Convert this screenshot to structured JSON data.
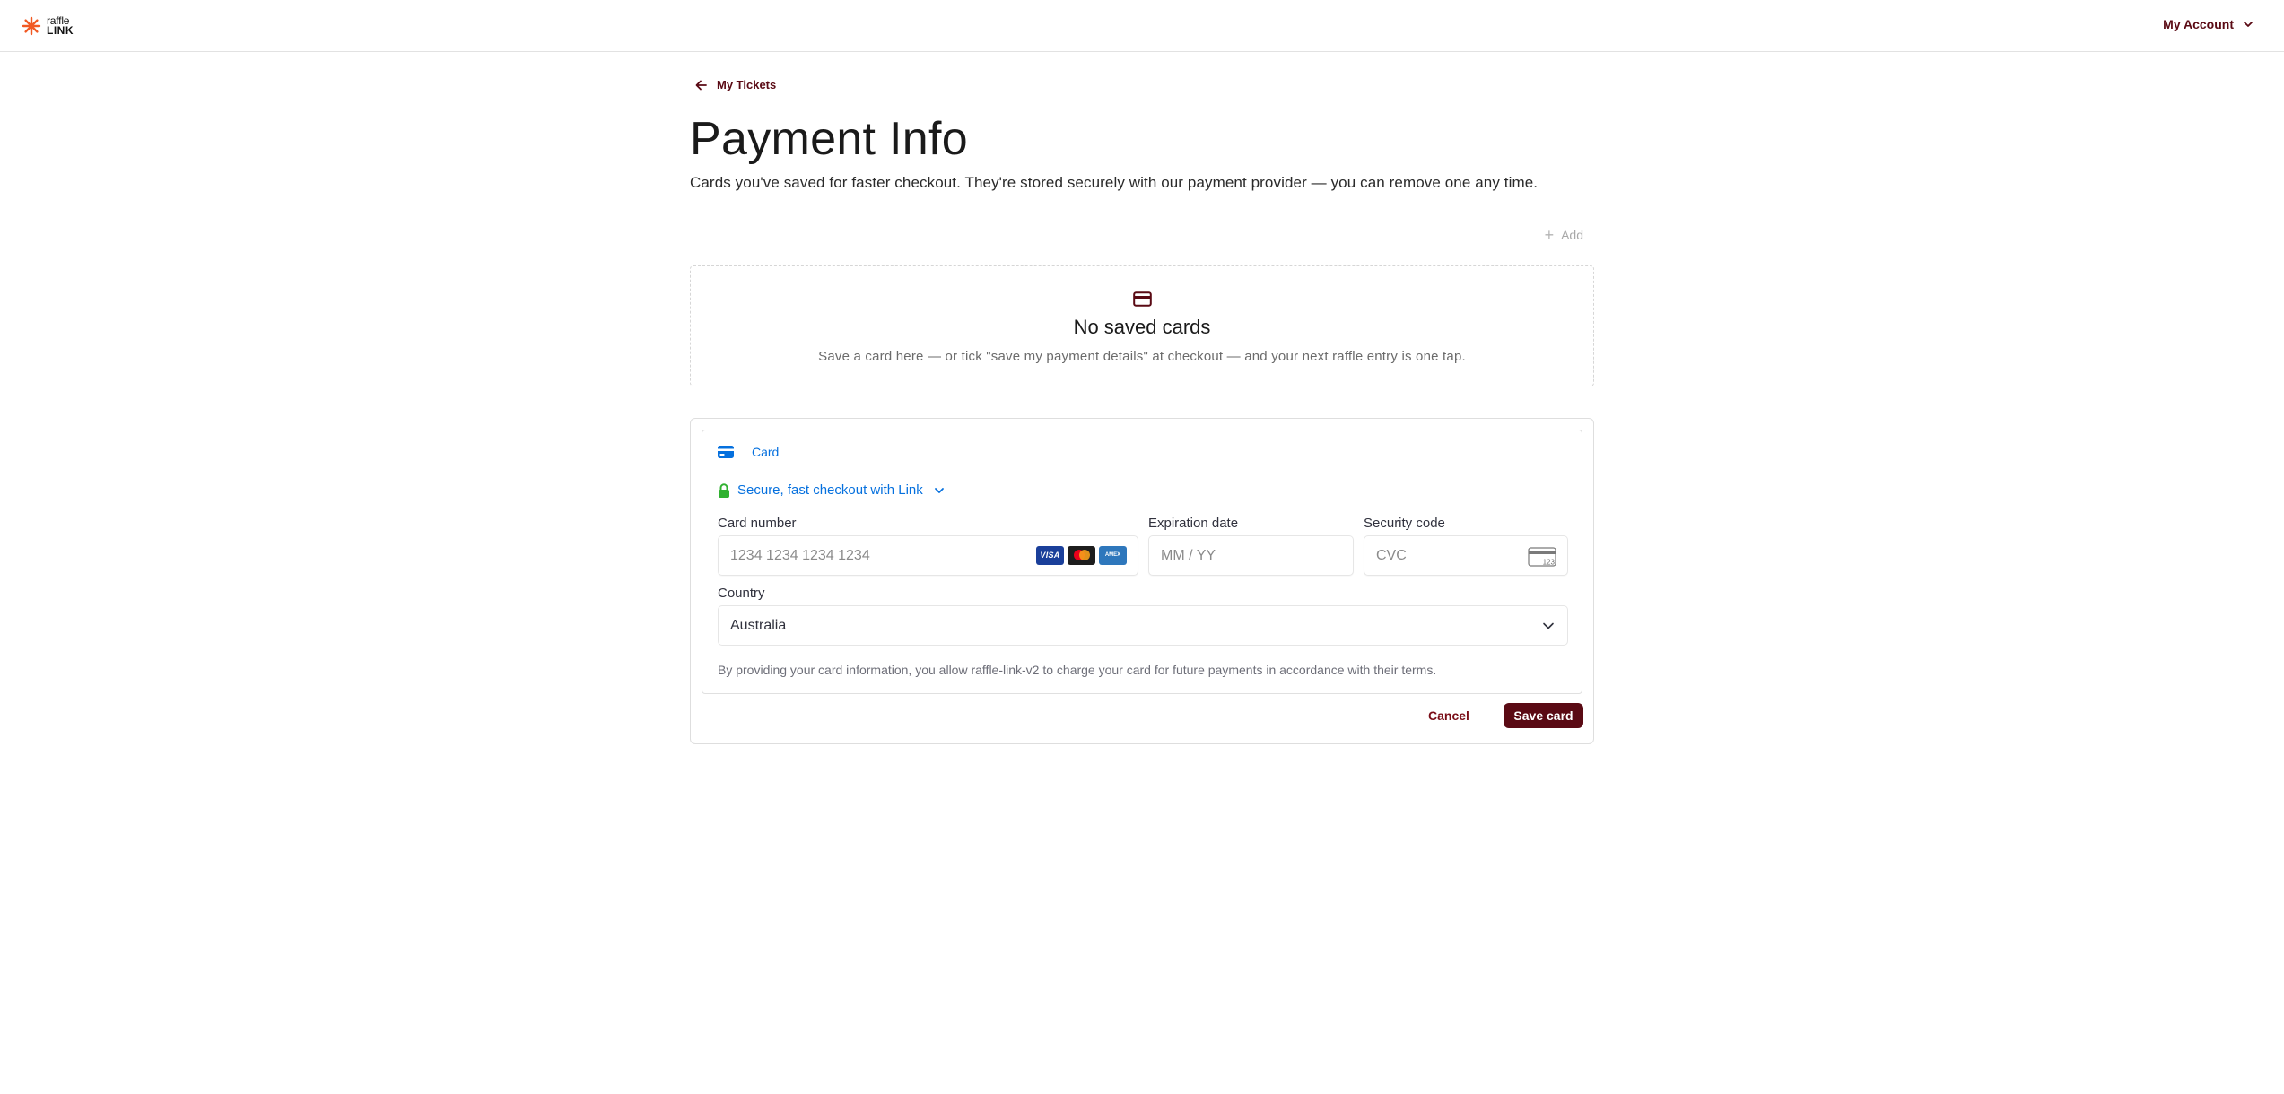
{
  "header": {
    "logo": {
      "line1": "raffle",
      "line2": "LINK",
      "icon": "asterisk-logo-icon",
      "color": "#f15a24"
    },
    "account_label": "My Account",
    "account_icon": "chevron-down-icon"
  },
  "main": {
    "back_link_label": "My Tickets",
    "back_icon": "arrow-left-icon",
    "title": "Payment Info",
    "subtitle": "Cards you've saved for faster checkout. They're stored securely with our payment provider — you can remove one any time.",
    "add_label": "Add",
    "add_icon": "plus-icon"
  },
  "empty_state": {
    "icon": "credit-card-icon",
    "title": "No saved cards",
    "description": "Save a card here — or tick \"save my payment details\" at checkout — and your next raffle entry is one tap."
  },
  "payment_form": {
    "method_tab_label": "Card",
    "method_icon": "card-icon",
    "link_label": "Secure, fast checkout with Link",
    "link_icons": [
      "lock-icon",
      "chevron-down-icon"
    ],
    "card_number": {
      "label": "Card number",
      "placeholder": "1234 1234 1234 1234",
      "value": "",
      "brands": [
        "VISA",
        "Mastercard",
        "AMEX"
      ]
    },
    "expiration": {
      "label": "Expiration date",
      "placeholder": "MM / YY",
      "value": ""
    },
    "security_code": {
      "label": "Security code",
      "placeholder": "CVC",
      "value": "",
      "icon_text": "123"
    },
    "country": {
      "label": "Country",
      "value": "Australia"
    },
    "legal_text": "By providing your card information, you allow raffle-link-v2 to charge your card for future payments in accordance with their terms."
  },
  "actions": {
    "cancel_label": "Cancel",
    "save_label": "Save card"
  },
  "colors": {
    "brand_dark": "#5a0a14",
    "link_blue": "#0570de",
    "lock_green": "#30b130",
    "logo_orange": "#f15a24"
  }
}
